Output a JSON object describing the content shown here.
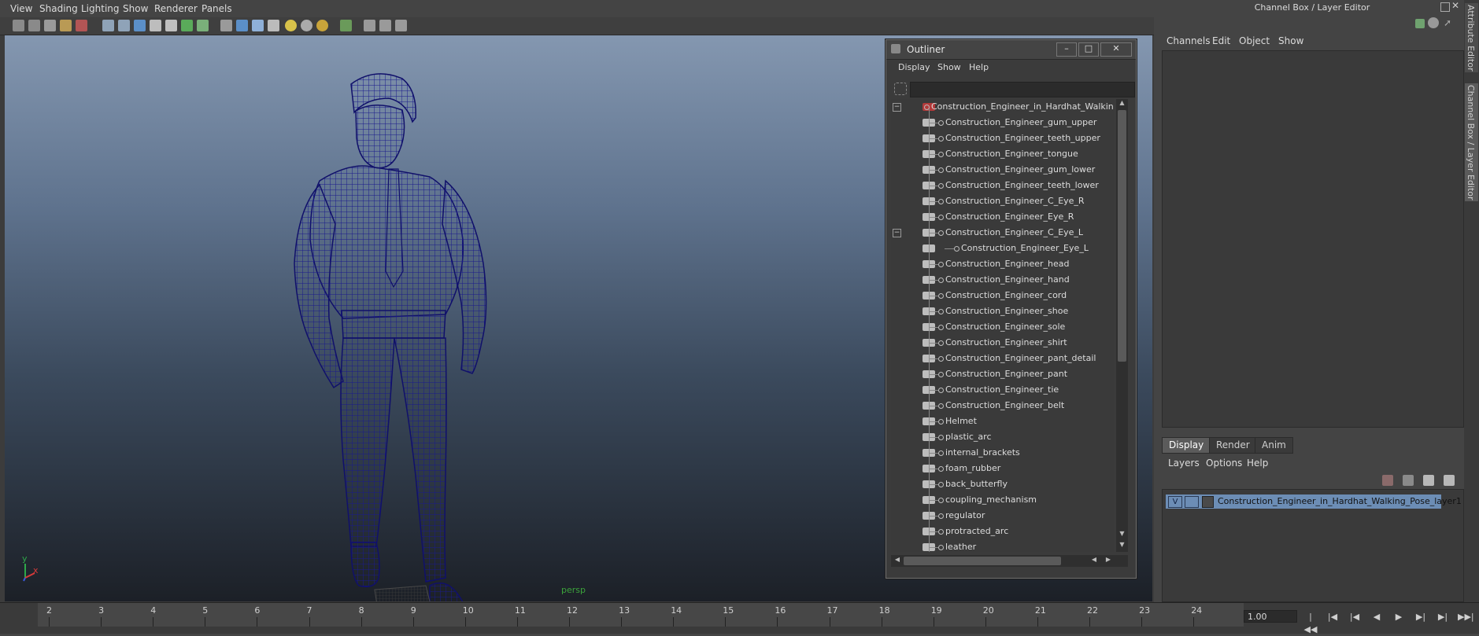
{
  "viewport": {
    "menus": [
      "View",
      "Shading",
      "Lighting",
      "Show",
      "Renderer",
      "Panels"
    ],
    "camera_label": "persp",
    "axis": {
      "y": "y",
      "x": "x"
    }
  },
  "outliner": {
    "title": "Outliner",
    "menus": [
      "Display",
      "Show",
      "Help"
    ],
    "filter_value": "",
    "items": [
      "Construction_Engineer_in_Hardhat_Walking",
      "Construction_Engineer_gum_upper",
      "Construction_Engineer_teeth_upper",
      "Construction_Engineer_tongue",
      "Construction_Engineer_gum_lower",
      "Construction_Engineer_teeth_lower",
      "Construction_Engineer_C_Eye_R",
      "Construction_Engineer_Eye_R",
      "Construction_Engineer_C_Eye_L",
      "Construction_Engineer_Eye_L",
      "Construction_Engineer_head",
      "Construction_Engineer_hand",
      "Construction_Engineer_cord",
      "Construction_Engineer_shoe",
      "Construction_Engineer_sole",
      "Construction_Engineer_shirt",
      "Construction_Engineer_pant_detail",
      "Construction_Engineer_pant",
      "Construction_Engineer_tie",
      "Construction_Engineer_belt",
      "Helmet",
      "plastic_arc",
      "internal_brackets",
      "foam_rubber",
      "back_butterfly",
      "coupling_mechanism",
      "regulator",
      "protracted_arc",
      "leather"
    ]
  },
  "channel_box": {
    "title": "Channel Box / Layer Editor",
    "menus": [
      "Channels",
      "Edit",
      "Object",
      "Show"
    ]
  },
  "layer_editor": {
    "tabs": [
      "Display",
      "Render",
      "Anim"
    ],
    "menus": [
      "Layers",
      "Options",
      "Help"
    ],
    "layer": {
      "visibility": "V",
      "name": "Construction_Engineer_in_Hardhat_Walking_Pose_layer1"
    }
  },
  "side_tabs": [
    "Attribute Editor",
    "Channel Box / Layer Editor"
  ],
  "timeline": {
    "ticks": [
      "2",
      "3",
      "4",
      "5",
      "6",
      "7",
      "8",
      "9",
      "10",
      "11",
      "12",
      "13",
      "14",
      "15",
      "16",
      "17",
      "18",
      "19",
      "20",
      "21",
      "22",
      "23",
      "24"
    ],
    "current_time": "1.00"
  },
  "colors": {
    "wireframe": "#1a1a8c",
    "selection": "#6c8db5",
    "camera_label": "#3ba33b"
  }
}
